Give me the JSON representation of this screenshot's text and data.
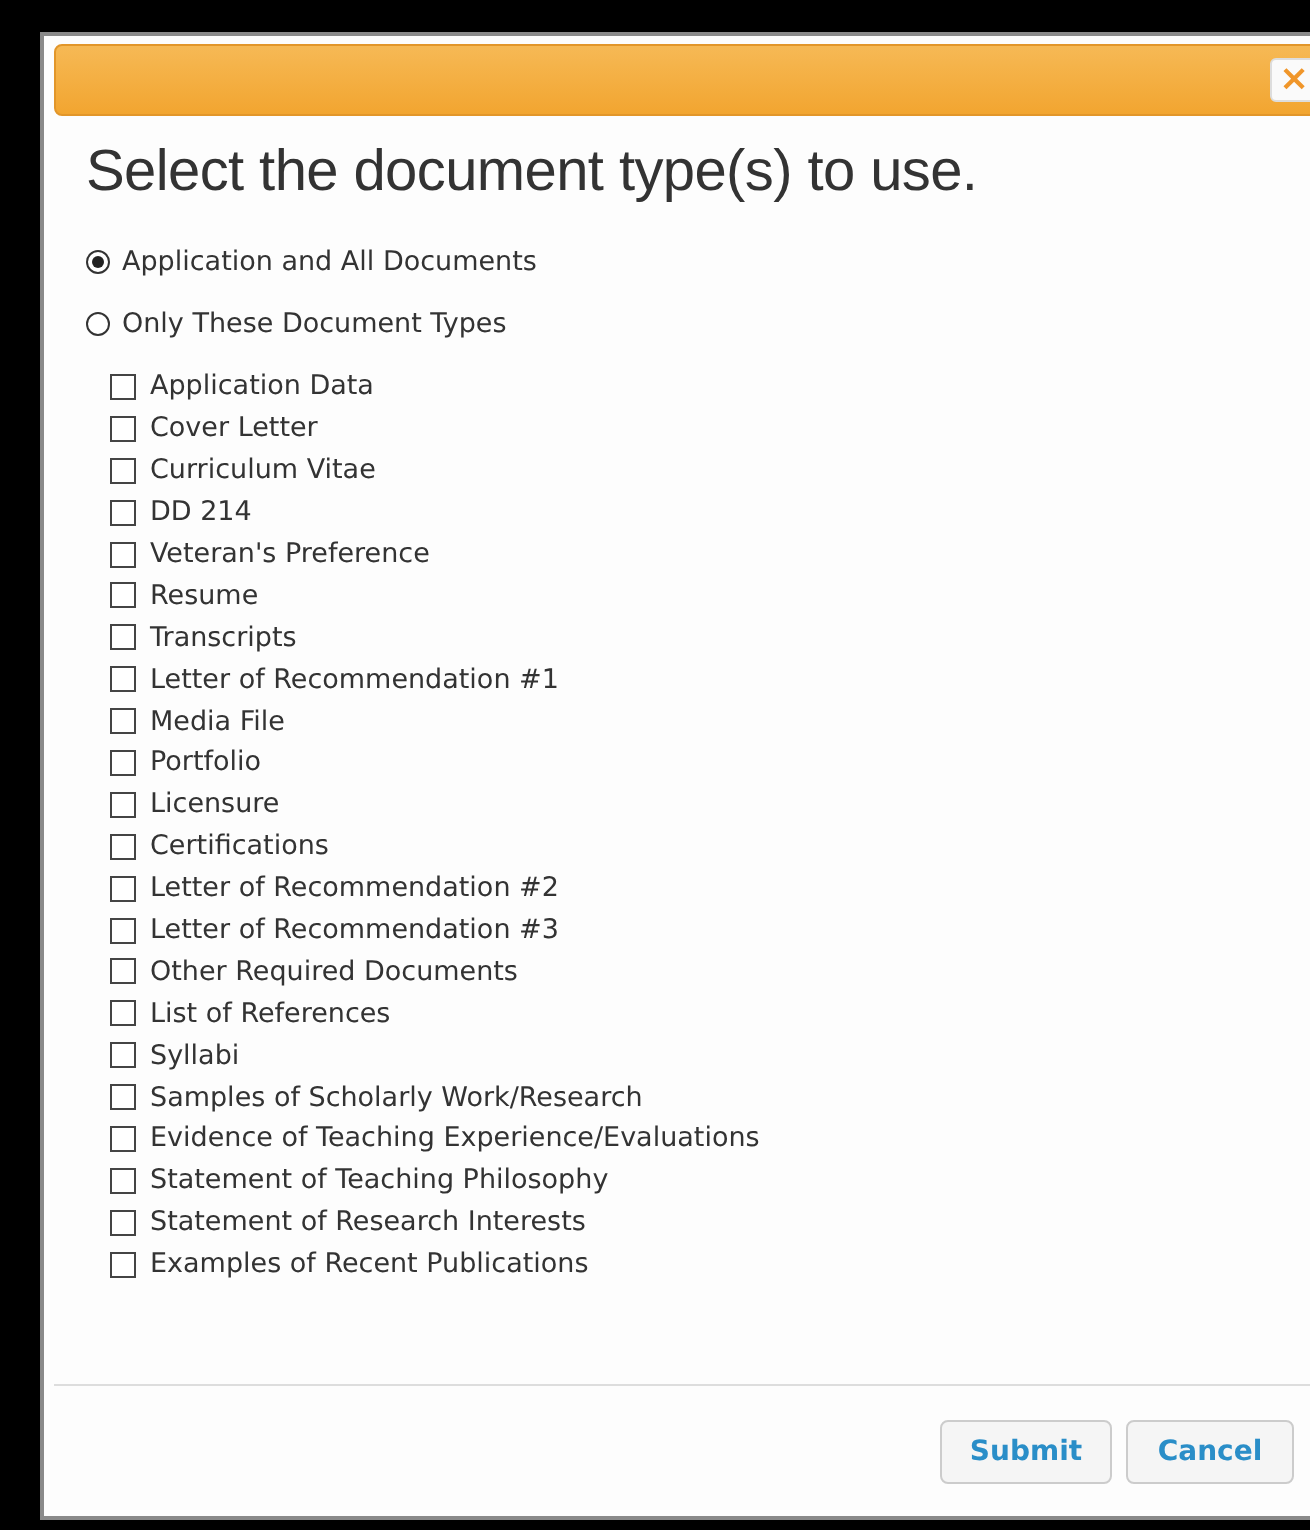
{
  "dialog": {
    "close_icon": "×",
    "title": "Select the document type(s) to use."
  },
  "scope_options": [
    {
      "label": "Application and All Documents",
      "selected": true
    },
    {
      "label": "Only These Document Types",
      "selected": false
    }
  ],
  "document_types": [
    {
      "label": "Application Data",
      "checked": false
    },
    {
      "label": "Cover Letter",
      "checked": false
    },
    {
      "label": "Curriculum Vitae",
      "checked": false
    },
    {
      "label": "DD 214",
      "checked": false
    },
    {
      "label": "Veteran's Preference",
      "checked": false
    },
    {
      "label": "Resume",
      "checked": false
    },
    {
      "label": "Transcripts",
      "checked": false
    },
    {
      "label": "Letter of Recommendation #1",
      "checked": false
    },
    {
      "label": "Media File",
      "checked": false
    },
    {
      "label": "Portfolio",
      "checked": false
    },
    {
      "label": "Licensure",
      "checked": false
    },
    {
      "label": "Certifications",
      "checked": false
    },
    {
      "label": "Letter of Recommendation #2",
      "checked": false
    },
    {
      "label": "Letter of Recommendation #3",
      "checked": false
    },
    {
      "label": "Other Required Documents",
      "checked": false
    },
    {
      "label": "List of References",
      "checked": false
    },
    {
      "label": "Syllabi",
      "checked": false
    },
    {
      "label": "Samples of Scholarly Work/Research",
      "checked": false
    },
    {
      "label": "Evidence of Teaching Experience/Evaluations",
      "checked": false
    },
    {
      "label": "Statement of Teaching Philosophy",
      "checked": false
    },
    {
      "label": "Statement of Research Interests",
      "checked": false
    },
    {
      "label": "Examples of Recent Publications",
      "checked": false
    }
  ],
  "buttons": [
    "Submit",
    "Cancel"
  ]
}
